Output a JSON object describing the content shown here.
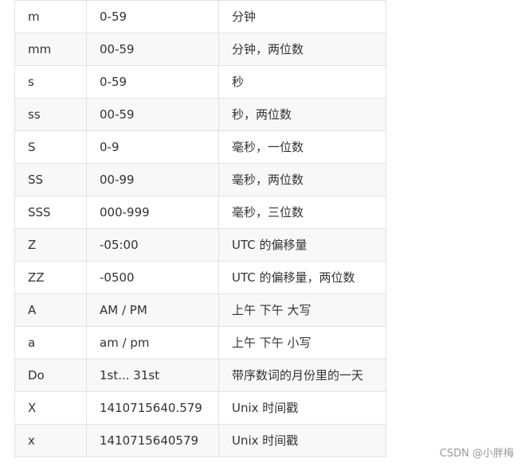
{
  "table": {
    "rows": [
      {
        "token": "m",
        "output": "0-59",
        "description": "分钟"
      },
      {
        "token": "mm",
        "output": "00-59",
        "description": "分钟，两位数"
      },
      {
        "token": "s",
        "output": "0-59",
        "description": "秒"
      },
      {
        "token": "ss",
        "output": "00-59",
        "description": "秒，两位数"
      },
      {
        "token": "S",
        "output": "0-9",
        "description": "毫秒，一位数"
      },
      {
        "token": "SS",
        "output": "00-99",
        "description": "毫秒，两位数"
      },
      {
        "token": "SSS",
        "output": "000-999",
        "description": "毫秒，三位数"
      },
      {
        "token": "Z",
        "output": "-05:00",
        "description": "UTC 的偏移量"
      },
      {
        "token": "ZZ",
        "output": "-0500",
        "description": "UTC 的偏移量，两位数"
      },
      {
        "token": "A",
        "output": "AM / PM",
        "description": "上午 下午 大写"
      },
      {
        "token": "a",
        "output": "am / pm",
        "description": "上午 下午 小写"
      },
      {
        "token": "Do",
        "output": "1st... 31st",
        "description": "带序数词的月份里的一天"
      },
      {
        "token": "X",
        "output": "1410715640.579",
        "description": "Unix 时间戳"
      },
      {
        "token": "x",
        "output": "1410715640579",
        "description": "Unix 时间戳"
      }
    ]
  },
  "watermark": {
    "text": "CSDN @小胖梅"
  }
}
